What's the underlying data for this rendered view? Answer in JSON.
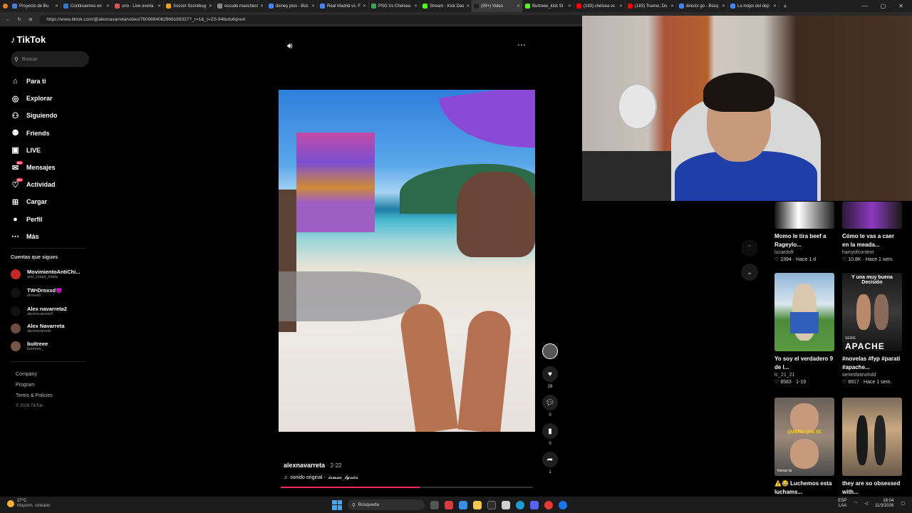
{
  "browser": {
    "tabs": [
      {
        "title": "Proyecto de Bu",
        "color": "#4a7fd4"
      },
      {
        "title": "Continuemos en",
        "color": "#2f7ad1"
      },
      {
        "title": "uno - Live overla",
        "color": "#d9534f"
      },
      {
        "title": "Soccer Scorebug",
        "color": "#f0a020"
      },
      {
        "title": "escudo manchest",
        "color": "#888888"
      },
      {
        "title": "disney plus - Bús",
        "color": "#4285f4"
      },
      {
        "title": "Real Madrid vs. F",
        "color": "#4285f4"
      },
      {
        "title": "PSG Vs Chelsea",
        "color": "#34a853"
      },
      {
        "title": "Stream - Kick Das",
        "color": "#53fc18"
      },
      {
        "title": "(99+) Video",
        "color": "#222222"
      },
      {
        "title": "Buitreee_kick St",
        "color": "#53fc18"
      },
      {
        "title": "(183) chelsea vs",
        "color": "#ff0000"
      },
      {
        "title": "(183) Trueno, Du",
        "color": "#ff0000"
      },
      {
        "title": "directv go - Búsq",
        "color": "#4285f4"
      },
      {
        "title": "Lo mejor del dep",
        "color": "#4285f4"
      }
    ],
    "active_tab": 9,
    "url": "https://www.tiktok.com/@alexnavarreta/video/7609884062966189337?_r=1&_t=ZS-94butu6qnu4"
  },
  "sidebar": {
    "logo": "TikTok",
    "search_placeholder": "Buscar",
    "nav": [
      {
        "label": "Para ti",
        "icon": "home-icon",
        "glyph": "⌂"
      },
      {
        "label": "Explorar",
        "icon": "compass-icon",
        "glyph": "◎"
      },
      {
        "label": "Siguiendo",
        "icon": "following-icon",
        "glyph": "⚇"
      },
      {
        "label": "Friends",
        "icon": "friends-icon",
        "glyph": "⚉"
      },
      {
        "label": "LIVE",
        "icon": "live-icon",
        "glyph": "▣"
      },
      {
        "label": "Mensajes",
        "icon": "messages-icon",
        "glyph": "✉",
        "badge": "99+"
      },
      {
        "label": "Actividad",
        "icon": "activity-icon",
        "glyph": "♡",
        "badge": "99+"
      },
      {
        "label": "Cargar",
        "icon": "upload-icon",
        "glyph": "⊞"
      },
      {
        "label": "Perfil",
        "icon": "profile-icon",
        "glyph": "●"
      },
      {
        "label": "Más",
        "icon": "more-icon",
        "glyph": "⋯"
      }
    ],
    "following_title": "Cuentas que sigues",
    "accounts": [
      {
        "name": "MovimientoAntiChi...",
        "handle": "anti_chiqui_mafia"
      },
      {
        "name": "TW•Droxxd😈",
        "handle": "droxxd1"
      },
      {
        "name": "Alex navarreta2",
        "handle": "alexnavarreta2"
      },
      {
        "name": "Alex Navarreta",
        "handle": "alexnavarreta"
      },
      {
        "name": "buitreee",
        "handle": "buitreee_"
      }
    ],
    "footer": [
      "Company",
      "Program",
      "Terms & Policies"
    ],
    "copyright": "© 2026 TikTok"
  },
  "video": {
    "author": "alexnavarreta",
    "date": "2-22",
    "sound": "sonido original - ",
    "sound_author": "𝓲𝓼𝓶𝓪𝓮_𝓵𝔂𝓻𝓲𝓬𝓼",
    "progress": 0.55,
    "likes": "28",
    "comments": "0",
    "saves": "0",
    "shares": "1"
  },
  "recommendations": [
    {
      "title": "Momo le tira beef a Rageylo...",
      "user": "lucardofr",
      "likes": "2394",
      "age": "Hace 1 d"
    },
    {
      "title": "Cómo te vas a caer en la meada...",
      "user": "harryofcontext",
      "likes": "10.8K",
      "age": "Hace 1 sem."
    },
    {
      "title": "Yo soy el verdadero 9 de l...",
      "user": "lc_21_21",
      "likes": "8583",
      "age": "1-19"
    },
    {
      "title": "#novelas #fyp #parati #apache...",
      "user": "seriesfatinohdd",
      "likes": "8917",
      "age": "Hace 1 sem."
    },
    {
      "title": "⚠️😂 Luchemos esta luchams...",
      "user": "",
      "likes": "",
      "age": ""
    },
    {
      "title": "they are so obsessed with...",
      "user": "",
      "likes": "",
      "age": ""
    }
  ],
  "thumb_text": {
    "t4": "Y una muy buena Decisión",
    "t4b": "APACHE",
    "t4c": "SERIE",
    "t5": "QUIERO QUE SE",
    "t5b": "frenar la"
  },
  "taskbar": {
    "temp": "27°C",
    "weather": "Mayorm. soleado",
    "search": "Búsqueda",
    "lang": "ESP",
    "region": "LAA",
    "time": "18:04",
    "date": "11/3/2026"
  }
}
